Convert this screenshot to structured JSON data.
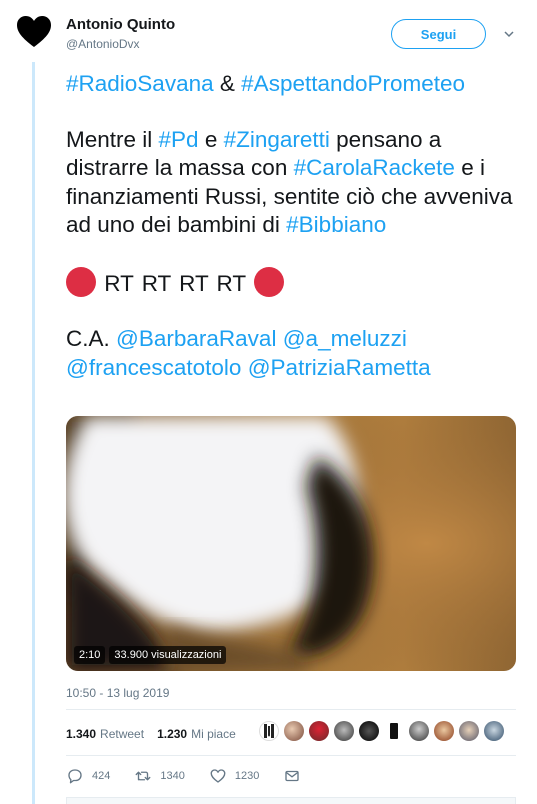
{
  "author": {
    "name": "Antonio Quinto",
    "handle": "@AntonioDvx",
    "avatar_icon": "black-heart-icon"
  },
  "follow_button": "Segui",
  "tweet": {
    "line1": {
      "tag1": "#RadioSavana",
      "amp": "&",
      "tag2": "#AspettandoPrometeo"
    },
    "para2": {
      "t1": "Mentre il ",
      "tag_pd": "#Pd",
      "t2": " e ",
      "tag_zing": "#Zingaretti",
      "t3": " pensano a distrarre la massa con ",
      "tag_carola": "#CarolaRackete",
      "t4": " e i finanziamenti Russi, sentite ciò che avveniva ad uno dei bambini di ",
      "tag_bibbiano": "#Bibbiano"
    },
    "rt_text": "RT RT RT RT",
    "rt_dot_color": "#dd2e44",
    "ca": {
      "prefix": "C.A.",
      "m1": "@BarbaraRaval",
      "m2": "@a_meluzzi",
      "m3": "@francescatotolo",
      "m4": "@PatriziaRametta"
    }
  },
  "media": {
    "duration": "2:10",
    "views": "33.900 visualizzazioni"
  },
  "timestamp": "10:50 - 13 lug 2019",
  "stats": {
    "retweets_count": "1.340",
    "retweets_label": "Retweet",
    "likes_count": "1.230",
    "likes_label": "Mi piace"
  },
  "actions": {
    "replies": "424",
    "retweets": "1340",
    "likes": "1230"
  },
  "colors": {
    "accent": "#1da1f2",
    "secondary_text": "#657786",
    "thread_line": "#cce8fb"
  }
}
